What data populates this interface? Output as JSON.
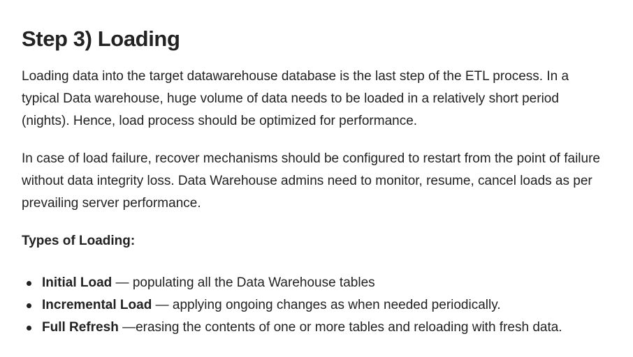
{
  "heading": "Step 3) Loading",
  "paragraphs": [
    "Loading data into the target datawarehouse database is the last step of the ETL process. In a typical Data warehouse, huge volume of data needs to be loaded in a relatively short period (nights). Hence, load process should be optimized for performance.",
    "In case of load failure, recover mechanisms should be configured to restart from the point of failure without data integrity loss. Data Warehouse admins need to monitor, resume, cancel loads as per prevailing server performance."
  ],
  "types_label": "Types of Loading:",
  "types": [
    {
      "term": "Initial Load",
      "description": " — populating all the Data Warehouse tables"
    },
    {
      "term": "Incremental Load",
      "description": " — applying ongoing changes as when needed periodically."
    },
    {
      "term": "Full Refresh",
      "description": " —erasing the contents of one or more tables and reloading with fresh data."
    }
  ]
}
